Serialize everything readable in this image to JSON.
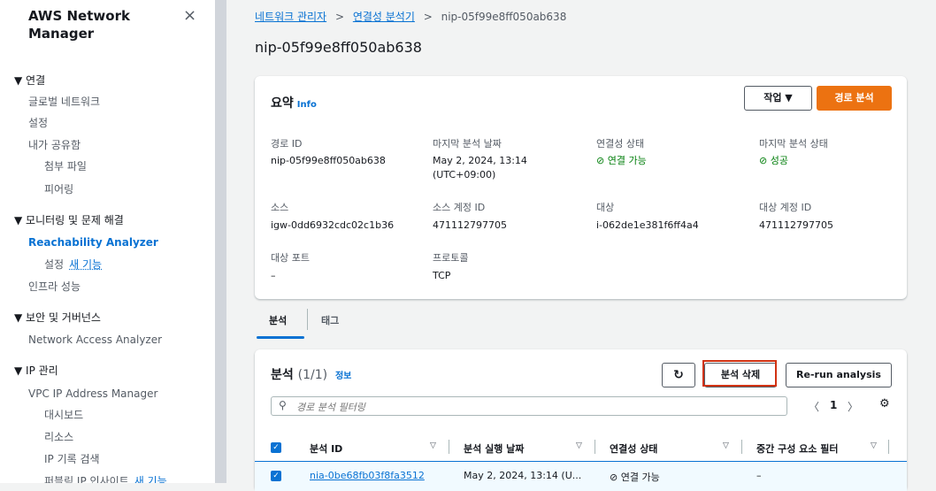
{
  "sidebar": {
    "title": "AWS Network Manager",
    "close_icon": "×",
    "items": [
      {
        "label": "▼ 연결"
      },
      {
        "label": "글로벌 네트워크"
      },
      {
        "label": "설정"
      },
      {
        "label": "내가 공유함"
      },
      {
        "label": "첨부 파일"
      },
      {
        "label": "피어링"
      },
      {
        "label": "▼ 모니터링 및 문제 해결"
      },
      {
        "label": "Reachability Analyzer"
      },
      {
        "label": "설정",
        "badge": "새 기능"
      },
      {
        "label": "인프라 성능"
      },
      {
        "label": "▼ 보안 및 거버넌스"
      },
      {
        "label": "Network Access Analyzer"
      },
      {
        "label": "▼ IP 관리"
      },
      {
        "label": "VPC IP Address Manager"
      },
      {
        "label": "대시보드"
      },
      {
        "label": "리소스"
      },
      {
        "label": "IP 기록 검색"
      },
      {
        "label": "퍼블릭 IP 인사이트",
        "badge": "새 기능"
      }
    ]
  },
  "breadcrumb": {
    "item1": "네트워크 관리자",
    "item2": "연결성 분석기",
    "separator": ">",
    "current": "nip-05f99e8ff050ab638"
  },
  "page_title": "nip-05f99e8ff050ab638",
  "summary": {
    "title": "요약",
    "info": "Info",
    "actions_button": "작업 ▼",
    "analyze_button": "경로 분석",
    "fields": {
      "path_id_label": "경로 ID",
      "path_id_value": "nip-05f99e8ff050ab638",
      "last_analysis_date_label": "마지막 분석 날짜",
      "last_analysis_date_value": "May 2, 2024, 13:14",
      "last_analysis_date_tz": "(UTC+09:00)",
      "reachability_label": "연결성 상태",
      "reachability_value": "연결 가능",
      "last_status_label": "마지막 분석 상태",
      "last_status_value": "성공",
      "source_label": "소스",
      "source_value": "igw-0dd6932cdc02c1b36",
      "source_account_label": "소스 계정 ID",
      "source_account_value": "471112797705",
      "dest_label": "대상",
      "dest_value": "i-062de1e381f6ff4a4",
      "dest_account_label": "대상 계정 ID",
      "dest_account_value": "471112797705",
      "dest_port_label": "대상 포트",
      "dest_port_value": "–",
      "protocol_label": "프로토콜",
      "protocol_value": "TCP"
    }
  },
  "tabs": [
    {
      "label": "분석"
    },
    {
      "label": "태그"
    }
  ],
  "analysis": {
    "title": "분석",
    "count": "(1/1)",
    "info": "정보",
    "refresh_icon": "↻",
    "delete_button": "분석 삭제",
    "rerun_button": "Re-run analysis",
    "filter_placeholder": "경로 분석 필터링",
    "page": "1",
    "prev_icon": "〈",
    "next_icon": "〉",
    "settings_icon": "⚙",
    "columns": [
      "분석 ID",
      "분석 실행 날짜",
      "연결성 상태",
      "중간 구성 요소 필터"
    ],
    "rows": [
      {
        "id": "nia-0be68fb03f8fa3512",
        "date": "May 2, 2024, 13:14 (U...",
        "status": "연결 가능",
        "filter": "–"
      }
    ]
  },
  "colors": {
    "accent": "#0972d3",
    "primary_button": "#ec7211",
    "success": "#037f0c",
    "highlight": "#d13212"
  }
}
